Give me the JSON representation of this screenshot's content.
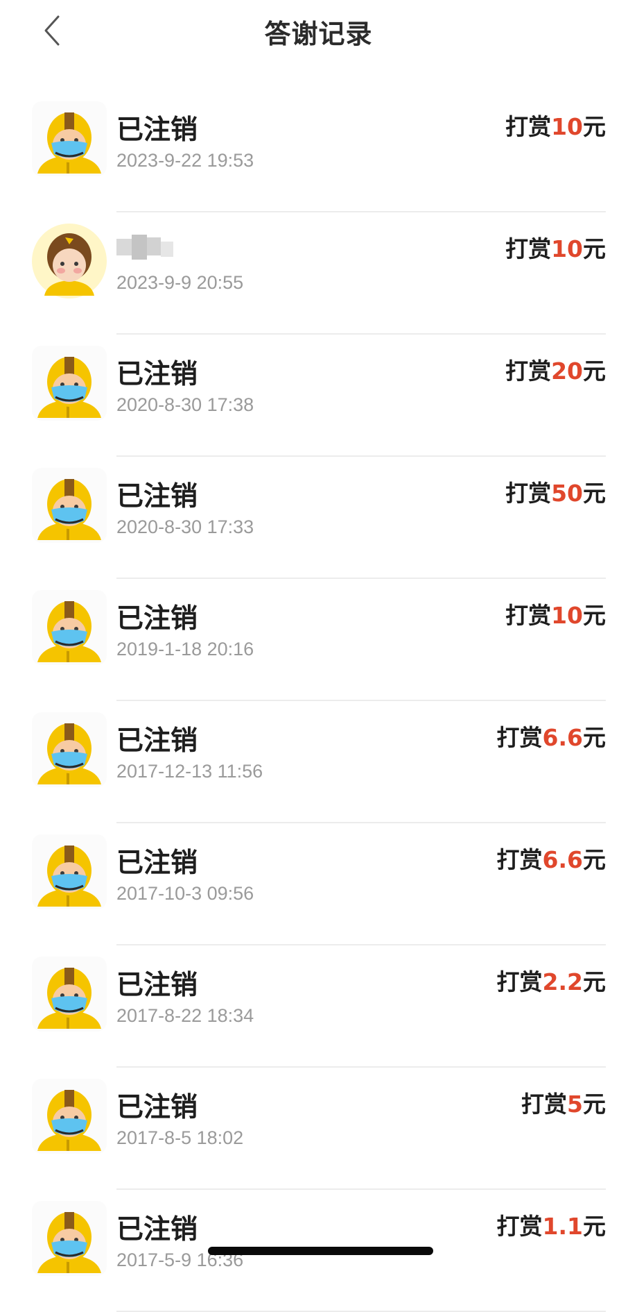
{
  "header": {
    "title": "答谢记录"
  },
  "records": [
    {
      "name": "已注销",
      "time": "2023-9-22 19:53",
      "prefix": "打赏",
      "amount": "10",
      "unit": "元",
      "avatar": "courier-mask-avatar"
    },
    {
      "name": "",
      "time": "2023-9-9 20:55",
      "prefix": "打赏",
      "amount": "10",
      "unit": "元",
      "avatar": "courier-brown-avatar"
    },
    {
      "name": "已注销",
      "time": "2020-8-30 17:38",
      "prefix": "打赏",
      "amount": "20",
      "unit": "元",
      "avatar": "courier-mask-avatar"
    },
    {
      "name": "已注销",
      "time": "2020-8-30 17:33",
      "prefix": "打赏",
      "amount": "50",
      "unit": "元",
      "avatar": "courier-mask-avatar"
    },
    {
      "name": "已注销",
      "time": "2019-1-18 20:16",
      "prefix": "打赏",
      "amount": "10",
      "unit": "元",
      "avatar": "courier-mask-avatar"
    },
    {
      "name": "已注销",
      "time": "2017-12-13 11:56",
      "prefix": "打赏",
      "amount": "6.6",
      "unit": "元",
      "avatar": "courier-mask-avatar"
    },
    {
      "name": "已注销",
      "time": "2017-10-3 09:56",
      "prefix": "打赏",
      "amount": "6.6",
      "unit": "元",
      "avatar": "courier-mask-avatar"
    },
    {
      "name": "已注销",
      "time": "2017-8-22 18:34",
      "prefix": "打赏",
      "amount": "2.2",
      "unit": "元",
      "avatar": "courier-mask-avatar"
    },
    {
      "name": "已注销",
      "time": "2017-8-5 18:02",
      "prefix": "打赏",
      "amount": "5",
      "unit": "元",
      "avatar": "courier-mask-avatar"
    },
    {
      "name": "已注销",
      "time": "2017-5-9 16:36",
      "prefix": "打赏",
      "amount": "1.1",
      "unit": "元",
      "avatar": "courier-mask-avatar"
    }
  ],
  "colors": {
    "amount": "#e0472c",
    "helmet": "#f5c400",
    "mask": "#5ec3f0"
  }
}
